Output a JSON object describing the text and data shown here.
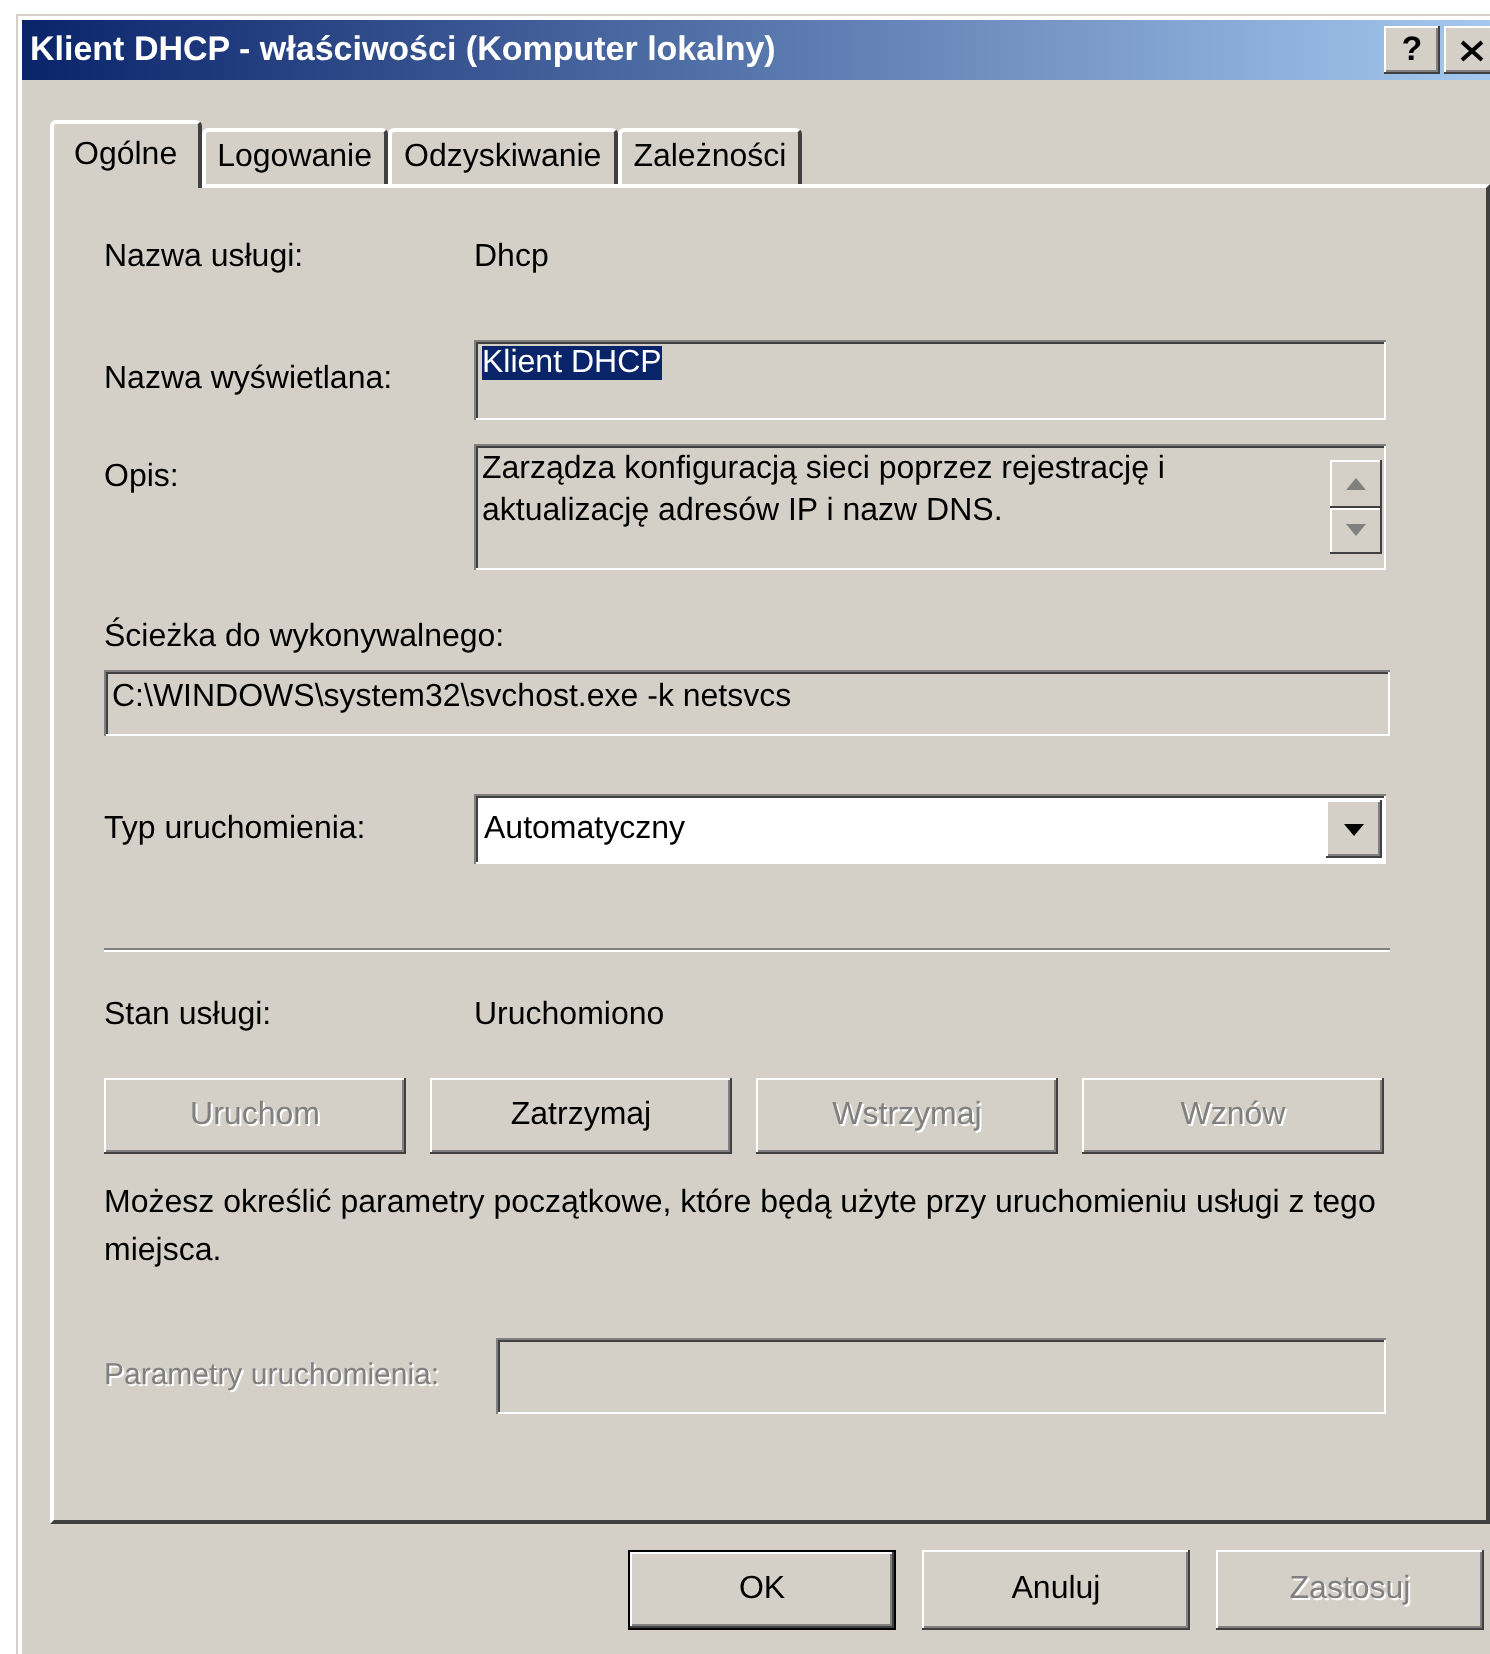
{
  "window": {
    "title": "Klient DHCP - właściwości (Komputer lokalny)",
    "help_button": "?"
  },
  "tabs": [
    {
      "label": "Ogólne",
      "selected": true
    },
    {
      "label": "Logowanie",
      "selected": false
    },
    {
      "label": "Odzyskiwanie",
      "selected": false
    },
    {
      "label": "Zależności",
      "selected": false
    }
  ],
  "service_name": {
    "label": "Nazwa usługi:",
    "value": "Dhcp"
  },
  "display_name": {
    "label": "Nazwa wyświetlana:",
    "value": "Klient DHCP",
    "selected": true
  },
  "description": {
    "label": "Opis:",
    "value": "Zarządza konfiguracją sieci poprzez rejestrację i aktualizację adresów IP i nazw DNS."
  },
  "executable_path": {
    "label": "Ścieżka do wykonywalnego:",
    "value": "C:\\WINDOWS\\system32\\svchost.exe -k netsvcs"
  },
  "startup_type": {
    "label": "Typ uruchomienia:",
    "value": "Automatyczny"
  },
  "service_status": {
    "label": "Stan usługi:",
    "value": "Uruchomiono"
  },
  "control_buttons": [
    {
      "label": "Uruchom",
      "disabled": true
    },
    {
      "label": "Zatrzymaj",
      "disabled": false
    },
    {
      "label": "Wstrzymaj",
      "disabled": true
    },
    {
      "label": "Wznów",
      "disabled": true
    }
  ],
  "note": "Możesz określić parametry początkowe, które będą użyte przy uruchomieniu usługi z tego miejsca.",
  "start_parameters": {
    "label": "Parametry uruchomienia:",
    "disabled": true
  },
  "dialog_buttons": [
    {
      "label": "OK",
      "disabled": false,
      "default": true
    },
    {
      "label": "Anuluj",
      "disabled": false,
      "default": false
    },
    {
      "label": "Zastosuj",
      "disabled": true,
      "default": false
    }
  ]
}
